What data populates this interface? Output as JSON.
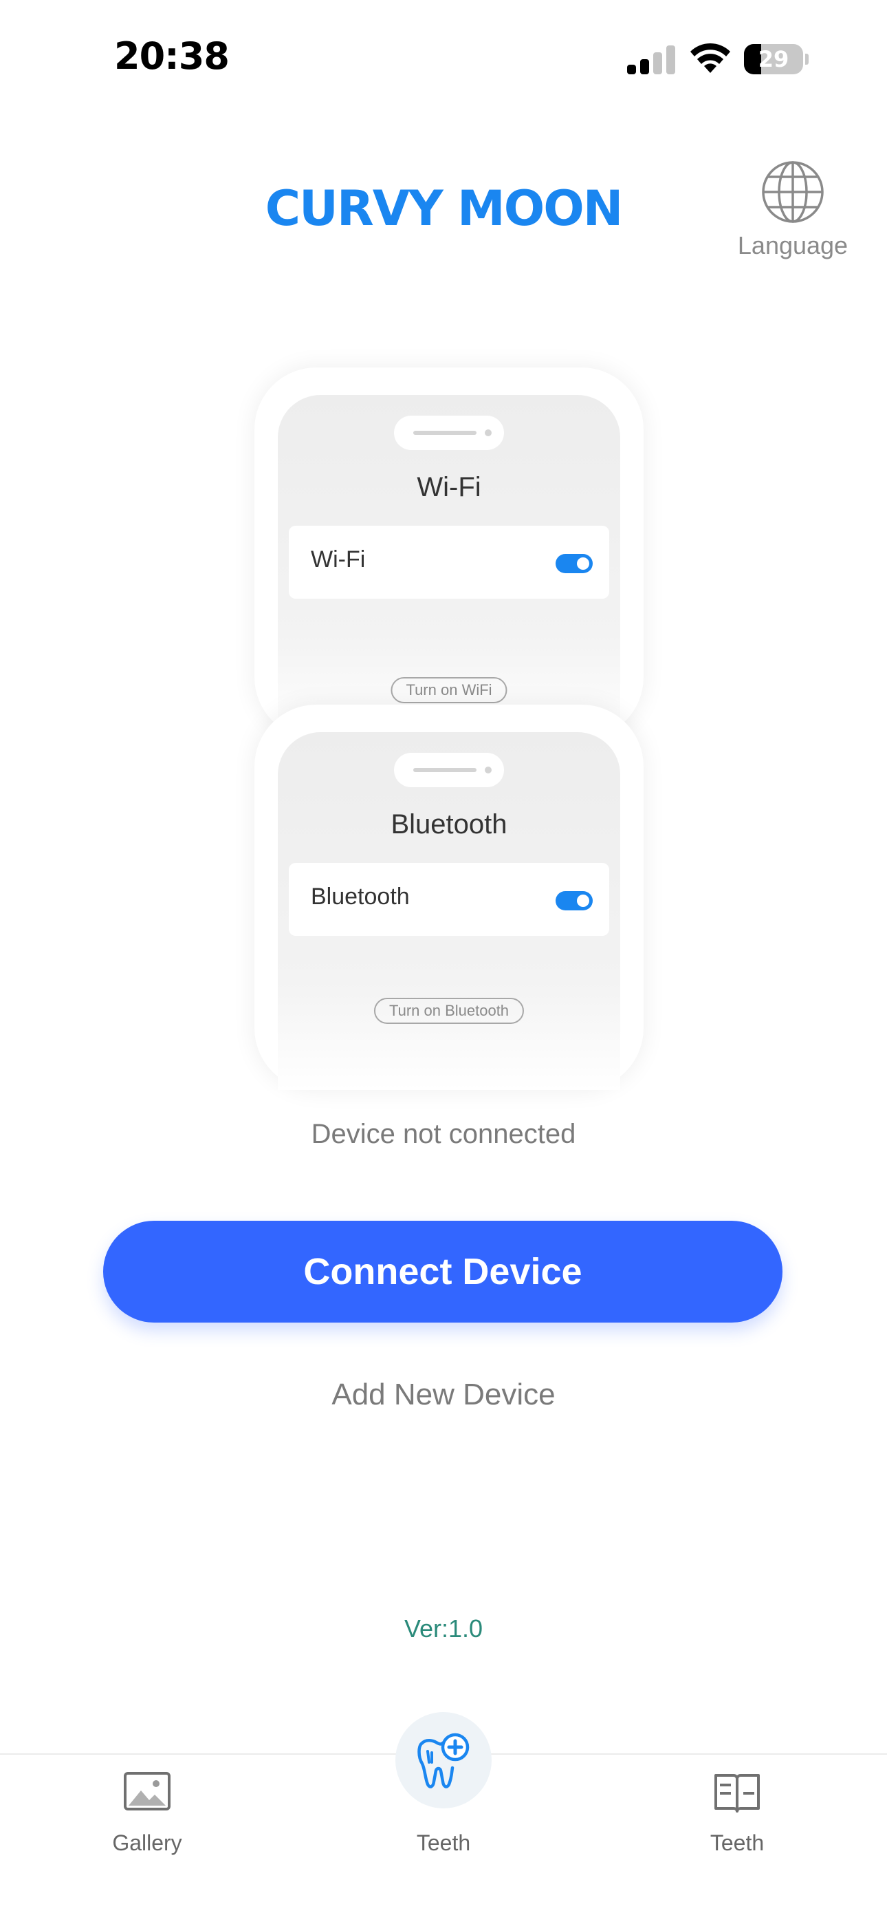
{
  "status_bar": {
    "time": "20:38",
    "battery_level": "29",
    "battery_fraction": 0.29
  },
  "header": {
    "title": "CURVY MOON",
    "language_label": "Language"
  },
  "illustration": {
    "wifi_card": {
      "title": "Wi-Fi",
      "row_label": "Wi-Fi",
      "toggle_on": true,
      "hint": "Turn on WiFi"
    },
    "bluetooth_card": {
      "title": "Bluetooth",
      "row_label": "Bluetooth",
      "toggle_on": true,
      "hint": "Turn on Bluetooth"
    }
  },
  "main": {
    "status_text": "Device not connected",
    "connect_button": "Connect Device",
    "add_device_link": "Add New Device",
    "version": "Ver:1.0"
  },
  "tabbar": {
    "items": [
      {
        "label": "Gallery",
        "icon": "image-icon"
      },
      {
        "label": "Teeth",
        "icon": "tooth-plus-icon",
        "active": true
      },
      {
        "label": "Teeth",
        "icon": "book-icon"
      }
    ]
  },
  "colors": {
    "brand": "#1a86f0",
    "button": "#3366ff",
    "version_text": "#2a8a7a",
    "muted_text": "#7a7a7a"
  }
}
